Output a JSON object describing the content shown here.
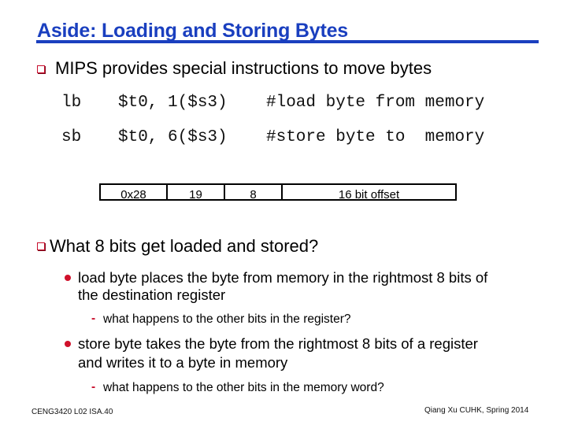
{
  "slide": {
    "title": "Aside: Loading and Storing Bytes",
    "bullets": [
      {
        "text": "MIPS provides special instructions to move bytes",
        "icon": "hollow-square-bullet"
      },
      {
        "text": "What 8 bits get loaded and stored?",
        "icon": "hollow-square-bullet"
      }
    ],
    "code": [
      {
        "op": "lb",
        "operands": "$t0, 1($s3)",
        "comment": "#load byte from memory"
      },
      {
        "op": "sb",
        "operands": "$t0, 6($s3)",
        "comment": "#store byte to  memory"
      }
    ],
    "instruction_format": {
      "fields": [
        "0x28",
        "19",
        "8",
        "16 bit offset"
      ]
    },
    "sub_bullets": [
      {
        "lines": [
          "load byte places the byte from memory in the rightmost 8 bits of",
          "the destination register"
        ],
        "icon": "red-dot-bullet",
        "question": "what happens to the other bits in the register?"
      },
      {
        "lines": [
          "store byte takes the byte from the rightmost 8 bits of a register",
          "and writes it to a byte in memory"
        ],
        "icon": "red-dot-bullet",
        "question": "what happens to the other bits in the memory word?"
      }
    ],
    "dash_symbol": "-",
    "footer": {
      "left": "CENG3420 L02 ISA.40",
      "right": "Qiang Xu  CUHK, Spring 2014"
    }
  },
  "colors": {
    "title": "#1a3fbf",
    "bullet_accent": "#c8102e",
    "text": "#000000",
    "background": "#ffffff"
  }
}
